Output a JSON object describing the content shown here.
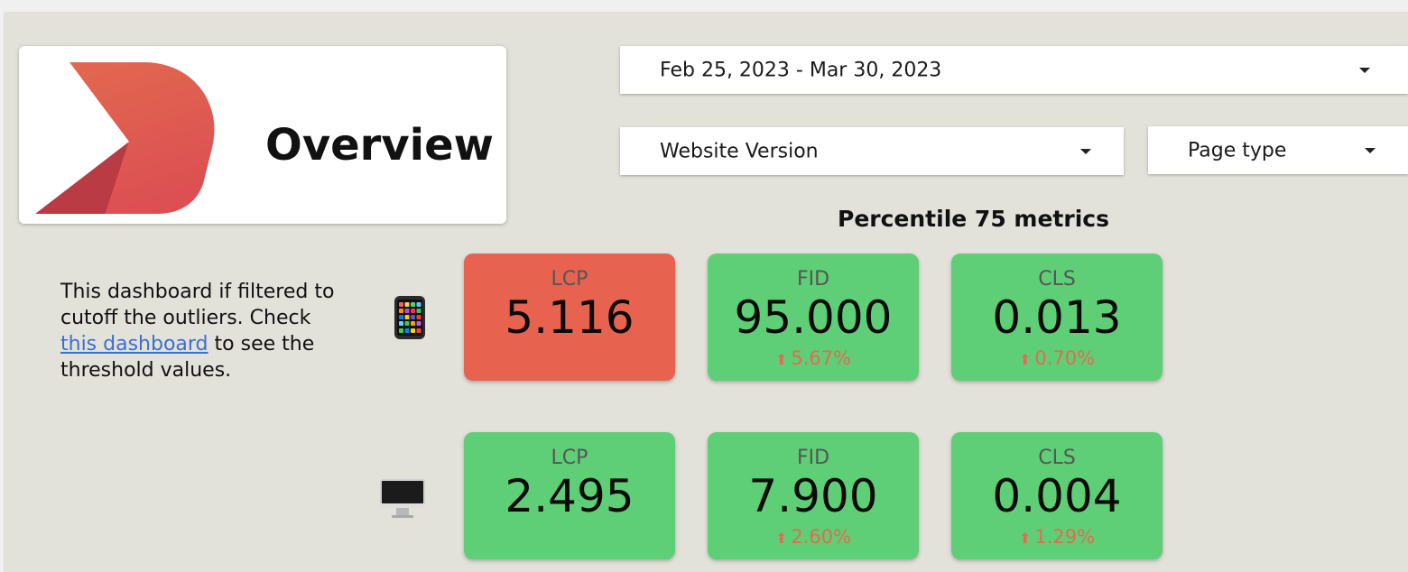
{
  "header": {
    "title": "Overview",
    "logo_colors": [
      "#e2674f",
      "#d9484d",
      "#b83a44"
    ]
  },
  "filters": {
    "date_range": "Feb 25, 2023 - Mar 30, 2023",
    "website_version": "Website Version",
    "page_type": "Page type"
  },
  "section_title": "Percentile 75 metrics",
  "note": {
    "before_link": "This dashboard if filtered to cutoff the outliers. Check ",
    "link_text": "this dashboard",
    "after_link": " to see the threshold values."
  },
  "rows": [
    {
      "device": "mobile-phone-icon",
      "metrics": [
        {
          "label": "LCP",
          "value": "5.116",
          "change": "",
          "status": "bad"
        },
        {
          "label": "FID",
          "value": "95.000",
          "change": "5.67%",
          "status": "good"
        },
        {
          "label": "CLS",
          "value": "0.013",
          "change": "0.70%",
          "status": "good"
        }
      ]
    },
    {
      "device": "desktop-computer-icon",
      "metrics": [
        {
          "label": "LCP",
          "value": "2.495",
          "change": "",
          "status": "good"
        },
        {
          "label": "FID",
          "value": "7.900",
          "change": "2.60%",
          "status": "good"
        },
        {
          "label": "CLS",
          "value": "0.004",
          "change": "1.29%",
          "status": "good"
        }
      ]
    }
  ],
  "colors": {
    "bad": "#e76350",
    "good": "#5ecf76",
    "change_text": "#e46a53",
    "link": "#3b6fd4",
    "background": "#e2e1da"
  }
}
